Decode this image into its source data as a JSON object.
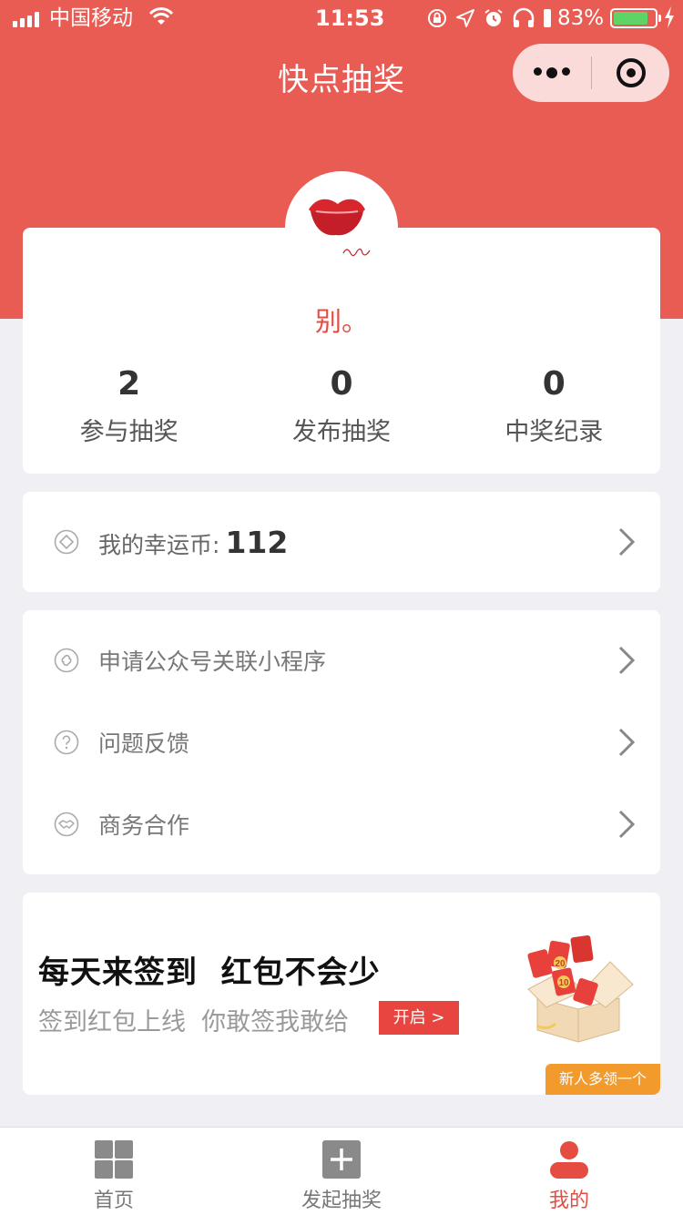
{
  "status_bar": {
    "carrier": "中国移动",
    "time": "11:53",
    "battery": "83%"
  },
  "nav": {
    "title": "快点抽奖"
  },
  "profile": {
    "username": "别。",
    "stats": [
      {
        "value": "2",
        "label": "参与抽奖"
      },
      {
        "value": "0",
        "label": "发布抽奖"
      },
      {
        "value": "0",
        "label": "中奖纪录"
      }
    ]
  },
  "coins": {
    "label": "我的幸运币:",
    "value": "112"
  },
  "menu": [
    {
      "label": "申请公众号关联小程序",
      "icon": "link-icon"
    },
    {
      "label": "问题反馈",
      "icon": "question-icon"
    },
    {
      "label": "商务合作",
      "icon": "handshake-icon"
    }
  ],
  "banner": {
    "title": "每天来签到  红包不会少",
    "subtitle": "签到红包上线  你敢签我敢给",
    "button": "开启 >",
    "badge": "新人多领一个",
    "gift_numbers": [
      "20",
      "10"
    ]
  },
  "tabs": [
    {
      "label": "首页",
      "icon": "grid-icon",
      "active": false
    },
    {
      "label": "发起抽奖",
      "icon": "plus-icon",
      "active": false
    },
    {
      "label": "我的",
      "icon": "person-icon",
      "active": true
    }
  ],
  "colors": {
    "accent": "#e95c53",
    "active_tab": "#e54d42",
    "badge": "#f39a2c"
  }
}
